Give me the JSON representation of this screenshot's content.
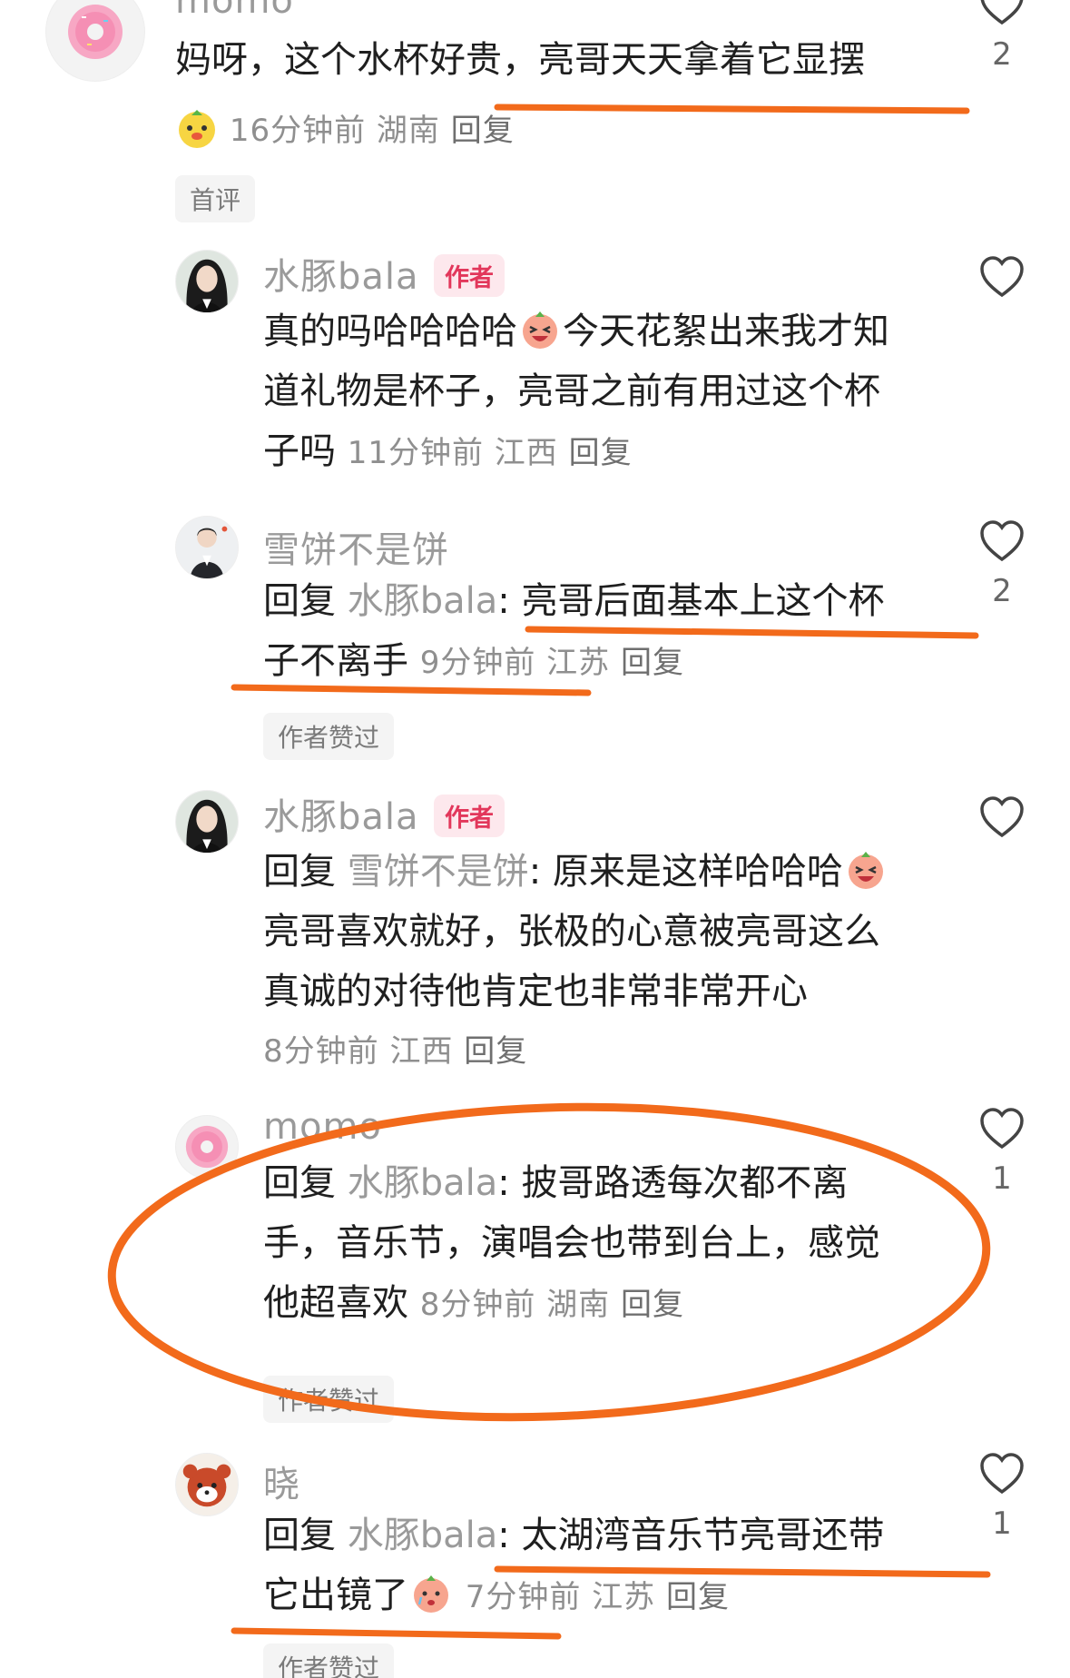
{
  "accent_color": "#f26a1b",
  "author_tag_color": "#e2375b",
  "comments": [
    {
      "username": "momo",
      "avatar_icon": "donut-icon",
      "text": "妈呀，这个水杯好贵，亮哥天天拿着它显摆",
      "time": "16分钟前",
      "location": "湖南",
      "reply_label": "回复",
      "likes": "2",
      "chip": "首评"
    },
    {
      "username": "水豚bala",
      "author_tag": "作者",
      "avatar_icon": "woman-portrait-icon",
      "line1a": "真的吗哈哈哈哈",
      "line1b": "今天花絮出来我才知",
      "line2": "道礼物是杯子，亮哥之前有用过这个杯",
      "line3": "子吗",
      "time": "11分钟前",
      "location": "江西",
      "reply_label": "回复"
    },
    {
      "username": "雪饼不是饼",
      "avatar_icon": "girl-portrait-icon",
      "reply_prefix": "回复",
      "mention": "水豚bala",
      "line1": ": 亮哥后面基本上这个杯",
      "line2": "子不离手",
      "time": "9分钟前",
      "location": "江苏",
      "reply_label": "回复",
      "likes": "2",
      "chip": "作者赞过"
    },
    {
      "username": "水豚bala",
      "author_tag": "作者",
      "avatar_icon": "woman-portrait-icon",
      "reply_prefix": "回复",
      "mention": "雪饼不是饼",
      "line1": ": 原来是这样哈哈哈",
      "line2": "亮哥喜欢就好，张极的心意被亮哥这么",
      "line3": "真诚的对待他肯定也非常非常开心",
      "time": "8分钟前",
      "location": "江西",
      "reply_label": "回复"
    },
    {
      "username": "momo",
      "avatar_icon": "donut-icon",
      "reply_prefix": "回复",
      "mention": "水豚bala",
      "line1": ": 披哥路透每次都不离",
      "line2": "手，音乐节，演唱会也带到台上，感觉",
      "line3": "他超喜欢",
      "time": "8分钟前",
      "location": "湖南",
      "reply_label": "回复",
      "likes": "1",
      "chip": "作者赞过"
    },
    {
      "username": "晓",
      "avatar_icon": "red-panda-icon",
      "reply_prefix": "回复",
      "mention": "水豚bala",
      "line1": ": 太湖湾音乐节亮哥还带",
      "line2": "它出镜了",
      "time": "7分钟前",
      "location": "江苏",
      "reply_label": "回复",
      "likes": "1",
      "chip": "作者赞过"
    }
  ]
}
